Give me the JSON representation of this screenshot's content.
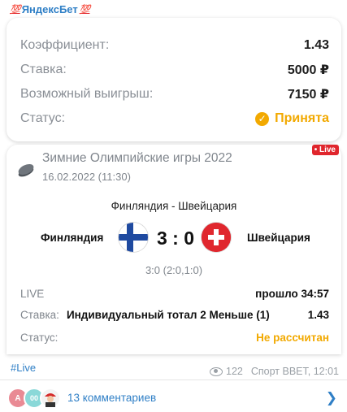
{
  "header": {
    "emoji_left": "💯",
    "title": "ЯндексБет",
    "emoji_right": "💯"
  },
  "bet_summary": {
    "rows": [
      {
        "label": "Коэффициент:",
        "value": "1.43"
      },
      {
        "label": "Ставка:",
        "value": "5000 ₽"
      },
      {
        "label": "Возможный выигрыш:",
        "value": "7150 ₽"
      }
    ],
    "status_label": "Статус:",
    "status_value": "Принята"
  },
  "event": {
    "live_badge": "• Live",
    "tournament": "Зимние Олимпийские игры 2022",
    "datetime": "16.02.2022 (11:30)",
    "match_title": "Финляндия - Швейцария",
    "team_home": "Финляндия",
    "team_away": "Швейцария",
    "score": "3 : 0",
    "periods": "3:0 (2:0,1:0)",
    "live_label": "LIVE",
    "elapsed": "прошло 34:57",
    "bet_label": "Ставка:",
    "bet_text": "Индивидуальный тотал 2 Меньше (1)",
    "bet_odds": "1.43",
    "status_label": "Статус:",
    "status_value": "Не рассчитан"
  },
  "post": {
    "hashtag": "#Live",
    "views": "122",
    "author_time": "Спорт BBET, 12:01",
    "avatar_1": "A",
    "avatar_2": "00",
    "comments": "13 комментариев"
  },
  "colors": {
    "accent_blue": "#2f7fc6",
    "status_orange": "#f2a900",
    "live_red": "#e0262d"
  },
  "icons": [
    "check-circle-icon",
    "hockey-puck-icon",
    "flag-finland-icon",
    "flag-switzerland-icon",
    "eye-icon",
    "chevron-right-icon"
  ]
}
